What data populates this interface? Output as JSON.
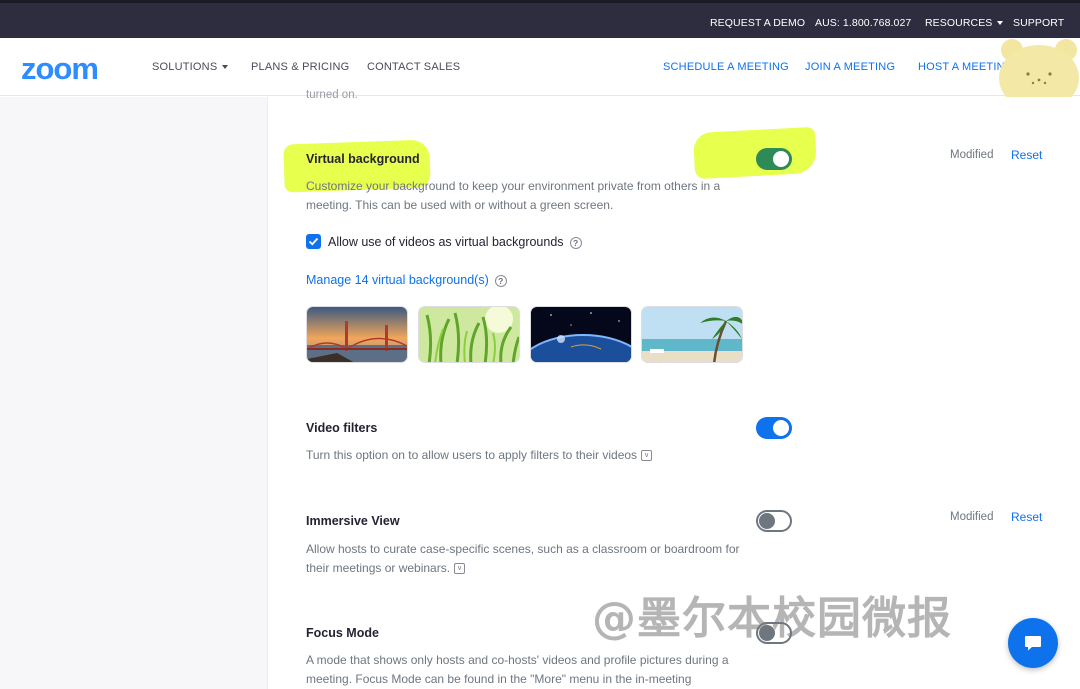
{
  "topbar": {
    "request_demo": "REQUEST A DEMO",
    "phone": "AUS: 1.800.768.027",
    "resources": "RESOURCES",
    "support": "SUPPORT"
  },
  "nav": {
    "logo": "zoom",
    "solutions": "SOLUTIONS",
    "plans": "PLANS & PRICING",
    "contact": "CONTACT SALES",
    "schedule": "SCHEDULE A MEETING",
    "join": "JOIN A MEETING",
    "host": "HOST A MEETING"
  },
  "content": {
    "partial_text": "turned on.",
    "virtual_background": {
      "title": "Virtual background",
      "description": "Customize your background to keep your environment private from others in a meeting. This can be used with or without a green screen.",
      "enabled": true,
      "modified": "Modified",
      "reset": "Reset",
      "allow_videos_label": "Allow use of videos as virtual backgrounds",
      "allow_videos_checked": true,
      "manage_link": "Manage 14 virtual background(s)",
      "thumbnails": [
        {
          "icon": "golden-gate-bridge-image"
        },
        {
          "icon": "green-grass-image"
        },
        {
          "icon": "earth-from-space-image"
        },
        {
          "icon": "tropical-beach-image"
        }
      ]
    },
    "video_filters": {
      "title": "Video filters",
      "description": "Turn this option on to allow users to apply filters to their videos",
      "enabled": true
    },
    "immersive_view": {
      "title": "Immersive View",
      "description": "Allow hosts to curate case-specific scenes, such as a classroom or boardroom for their meetings or webinars.",
      "enabled": false,
      "modified": "Modified",
      "reset": "Reset"
    },
    "focus_mode": {
      "title": "Focus Mode",
      "description": "A mode that shows only hosts and co-hosts' videos and profile pictures during a meeting. Focus Mode can be found in the \"More\" menu in the in-meeting",
      "enabled": false
    }
  },
  "watermark": "@墨尔本校园微报",
  "colors": {
    "accent": "#0e72ed",
    "topbar": "#2d2d3f",
    "highlight": "#e4ff3a"
  },
  "icons": {
    "chat": "chat-bubble-icon",
    "help": "question-circle-icon",
    "vicon": "info-v-icon"
  }
}
